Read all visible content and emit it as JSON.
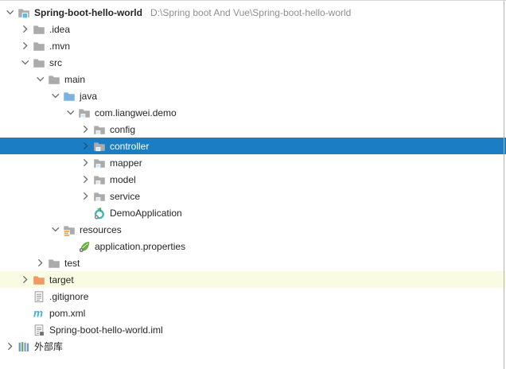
{
  "colors": {
    "selection_blue": "#1B7DC4",
    "excluded_row_bg": "#FAFBE3",
    "folder_gray": "#ABABAB",
    "source_folder_blue": "#7CB2DE",
    "excluded_folder_orange": "#EF9A62",
    "project_badge_blue": "#5FB7E8",
    "package_badge": "#D9E7F4",
    "resources_badge_yellow": "#E3A53C",
    "spring_green": "#68B03E",
    "spring_boot_teal": "#3FB8B2",
    "flag_green": "#59B54A",
    "maven_blue": "#49AEDB",
    "library_blue": "#6E9BC4",
    "library_green": "#63AC63",
    "library_gray": "#8CA0B2",
    "chevron_gray": "#696969",
    "chevron_selected": "#10557F",
    "path_text_gray": "#8f8f8f"
  },
  "tree": {
    "rows": [
      {
        "label": "Spring-boot-hello-world",
        "path_suffix": "D:\\Spring boot And Vue\\Spring-boot-hello-world",
        "level": 0,
        "chevron": "expanded",
        "icon": "project-folder-icon",
        "bold": true
      },
      {
        "label": ".idea",
        "level": 1,
        "chevron": "collapsed",
        "icon": "folder-icon"
      },
      {
        "label": ".mvn",
        "level": 1,
        "chevron": "collapsed",
        "icon": "folder-icon"
      },
      {
        "label": "src",
        "level": 1,
        "chevron": "expanded",
        "icon": "folder-icon"
      },
      {
        "label": "main",
        "level": 2,
        "chevron": "expanded",
        "icon": "folder-icon"
      },
      {
        "label": "java",
        "level": 3,
        "chevron": "expanded",
        "icon": "source-folder-icon"
      },
      {
        "label": "com.liangwei.demo",
        "level": 4,
        "chevron": "expanded",
        "icon": "package-icon"
      },
      {
        "label": "config",
        "level": 5,
        "chevron": "collapsed",
        "icon": "package-icon"
      },
      {
        "label": "controller",
        "level": 5,
        "chevron": "collapsed",
        "icon": "package-icon",
        "selected": true
      },
      {
        "label": "mapper",
        "level": 5,
        "chevron": "collapsed",
        "icon": "package-icon"
      },
      {
        "label": "model",
        "level": 5,
        "chevron": "collapsed",
        "icon": "package-icon"
      },
      {
        "label": "service",
        "level": 5,
        "chevron": "collapsed",
        "icon": "package-icon"
      },
      {
        "label": "DemoApplication",
        "level": 5,
        "chevron": "none",
        "icon": "spring-boot-class-icon"
      },
      {
        "label": "resources",
        "level": 3,
        "chevron": "expanded",
        "icon": "resources-folder-icon"
      },
      {
        "label": "application.properties",
        "level": 4,
        "chevron": "none",
        "icon": "spring-properties-icon"
      },
      {
        "label": "test",
        "level": 2,
        "chevron": "collapsed",
        "icon": "folder-icon"
      },
      {
        "label": "target",
        "level": 1,
        "chevron": "collapsed",
        "icon": "excluded-folder-icon",
        "excluded": true
      },
      {
        "label": ".gitignore",
        "level": 1,
        "chevron": "none",
        "icon": "text-file-icon"
      },
      {
        "label": "pom.xml",
        "level": 1,
        "chevron": "none",
        "icon": "maven-icon"
      },
      {
        "label": "Spring-boot-hello-world.iml",
        "level": 1,
        "chevron": "none",
        "icon": "module-file-icon"
      },
      {
        "label": "外部库",
        "level": 0,
        "chevron": "collapsed",
        "icon": "external-libraries-icon"
      }
    ]
  }
}
